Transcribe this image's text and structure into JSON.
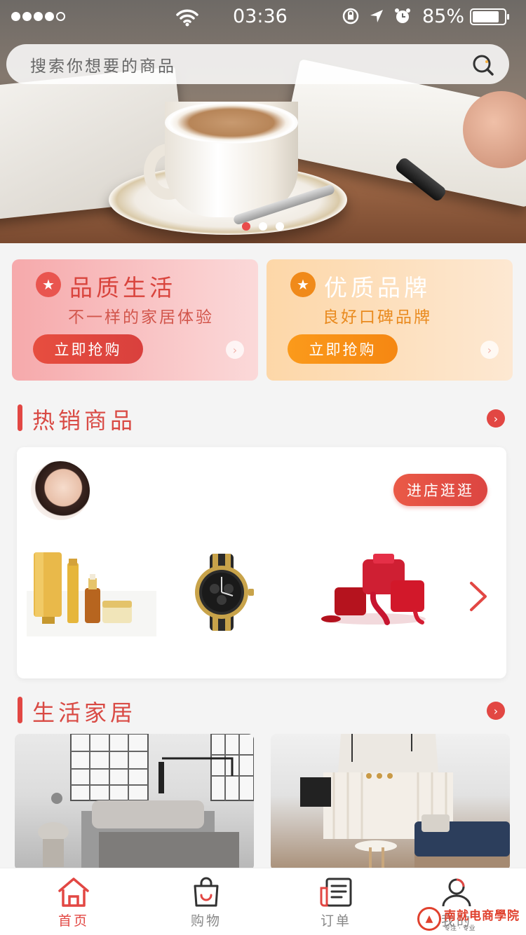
{
  "status_bar": {
    "time": "03:36",
    "battery_percent_text": "85%",
    "battery_level": 0.85,
    "signal_bars": 4
  },
  "search": {
    "placeholder": "搜索你想要的商品"
  },
  "banner": {
    "slide_count": 3,
    "active_slide": 1
  },
  "promos": [
    {
      "title": "品质生活",
      "subtitle": "不一样的家居体验",
      "button": "立即抢购"
    },
    {
      "title": "优质品牌",
      "subtitle": "良好口碑品牌",
      "button": "立即抢购"
    }
  ],
  "sections": {
    "hot": {
      "title": "热销商品",
      "visit_button": "进店逛逛"
    },
    "living": {
      "title": "生活家居"
    }
  },
  "products": [
    "cosmetics-product",
    "watch-product",
    "nail-polish-product"
  ],
  "tabs": [
    {
      "label": "首页",
      "icon": "home-icon",
      "active": true
    },
    {
      "label": "购物",
      "icon": "shopping-bag-icon",
      "active": false
    },
    {
      "label": "订单",
      "icon": "orders-icon",
      "active": false
    },
    {
      "label": "我的",
      "icon": "profile-icon",
      "active": false
    }
  ],
  "watermark": {
    "main": "南就电商學院",
    "sub": "专注 · 专业"
  },
  "colors": {
    "accent": "#e24743",
    "orange": "#f58712"
  }
}
